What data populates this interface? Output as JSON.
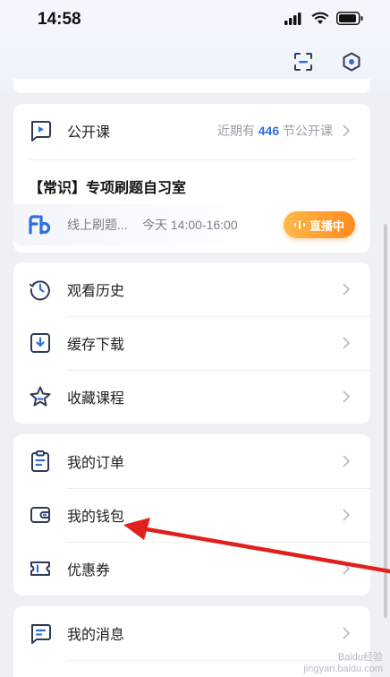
{
  "status_bar": {
    "time": "14:58"
  },
  "open_course": {
    "label": "公开课",
    "sub_prefix": "近期有",
    "sub_count": "446",
    "sub_suffix": "节公开课",
    "course_title": "【常识】专项刷题自习室",
    "course_desc": "线上刷题...",
    "course_time": "今天 14:00-16:00",
    "live_label": "直播中"
  },
  "menu_group_1": [
    {
      "label": "观看历史",
      "icon": "history-clock-icon"
    },
    {
      "label": "缓存下载",
      "icon": "download-icon"
    },
    {
      "label": "收藏课程",
      "icon": "star-icon"
    }
  ],
  "menu_group_2": [
    {
      "label": "我的订单",
      "icon": "order-clipboard-icon"
    },
    {
      "label": "我的钱包",
      "icon": "wallet-icon"
    },
    {
      "label": "优惠券",
      "icon": "coupon-icon"
    }
  ],
  "menu_group_3": [
    {
      "label": "我的消息",
      "icon": "message-icon"
    }
  ],
  "annotation": {
    "color": "#e0201e",
    "target": "我的钱包"
  },
  "watermark": {
    "line1": "Baidu经验",
    "line2": "jingyan.baidu.com"
  }
}
